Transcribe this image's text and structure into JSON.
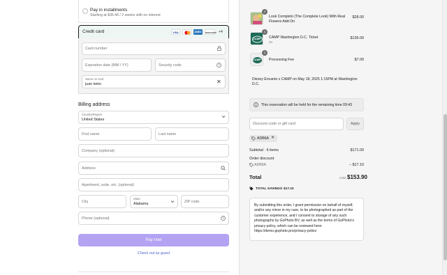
{
  "payment": {
    "installments_title": "Pay in installments",
    "installments_sub": "Starting at $36.46 / 2 weeks with no interest",
    "credit_card_label": "Credit card",
    "card_logos": [
      "VISA",
      "MC",
      "AMEX",
      "DISCOVER"
    ],
    "more_logos": "+4",
    "card_number_placeholder": "Card number",
    "expiration_placeholder": "Expiration date (MM / YY)",
    "security_code_placeholder": "Security code",
    "name_on_card_label": "Name on card",
    "name_on_card_value": "juan keko"
  },
  "billing": {
    "heading": "Billing address",
    "country_label": "Country/Region",
    "country_value": "United States",
    "first_name_placeholder": "First name",
    "last_name_placeholder": "Last name",
    "company_placeholder": "Company (optional)",
    "address_placeholder": "Address",
    "apartment_placeholder": "Apartment, suite, etc. (optional)",
    "city_placeholder": "City",
    "state_label": "State",
    "state_value": "Alabama",
    "zip_placeholder": "ZIP code",
    "phone_placeholder": "Phone (optional)"
  },
  "actions": {
    "pay_now": "Pay now",
    "checkout_guest": "Check out as guest"
  },
  "summary": {
    "items": [
      {
        "name": "Look Completo (The Complete Look) With Real Flowers Add-On",
        "sub": "",
        "qty": "1",
        "price": "$28.00"
      },
      {
        "name": "CAMP Washington D.C. Ticket",
        "sub": "34",
        "qty": "1",
        "price": "$136.00"
      },
      {
        "name": "Processing Fee",
        "sub": "",
        "qty": "1",
        "price": "$7.00"
      }
    ],
    "thumb_text": "CAMP",
    "description": "Disney Encanto x CAMP on May 18, 2025 1:15PM at Washington D.C.",
    "timer_text": "This reservation will be held for the remaining time 09:43",
    "discount_placeholder": "Discount code or gift card",
    "apply_label": "Apply",
    "chip_code": "ADB6A",
    "subtotal_label": "Subtotal · 6 items",
    "subtotal_value": "$171.00",
    "order_discount_label": "Order discount",
    "discount_code": "ADB6A",
    "discount_value": "− $17.10",
    "total_label": "Total",
    "currency": "USD",
    "total_value": "$153.90",
    "total_savings_label": "TOTAL SAVINGS",
    "total_savings_value": "$17.10",
    "consent_text": "By submitting this order, I grant permission on behalf of myself, and/or any minor in my care, to be photographed as part of the customer experience, and I consent to storage of any such photographs by GoPhoto BV, as well as the terms of GoPhoto's privacy policy, which can be reviewed here: https://demo.gophoto.pro/privacy-police"
  },
  "colors": {
    "accent": "#b4a2f2",
    "link": "#4b63d6",
    "selected_bg": "#eef6f4"
  }
}
